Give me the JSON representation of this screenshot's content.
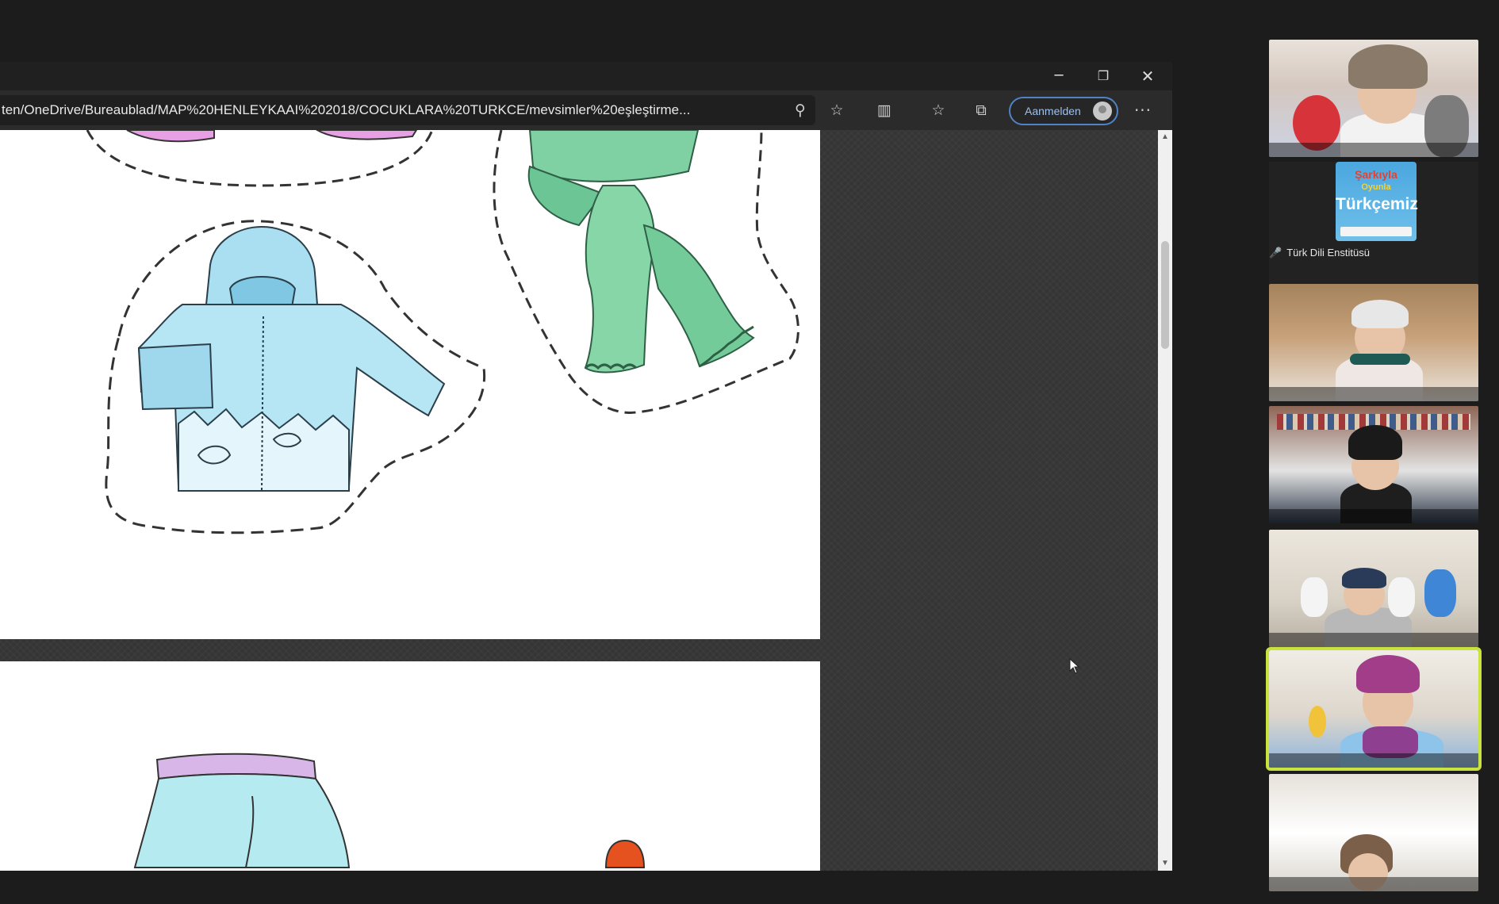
{
  "browser": {
    "window_controls": {
      "minimize": "─",
      "restore": "❐",
      "close": "✕"
    },
    "address": "ten/OneDrive/Bureaublad/MAP%20HENLEYKAAI%202018/COCUKLARA%20TURKCE/mevsimler%20eşleştirme...",
    "signin_label": "Aanmelden",
    "icons": {
      "zoom": "zoom-icon",
      "add_favorite": "favorite-add-icon",
      "reader": "immersive-reader-icon",
      "favorites": "favorites-icon",
      "collections": "collections-icon",
      "more": "more-icon"
    },
    "glyphs": {
      "zoom": "⚲",
      "add_favorite": "☆",
      "reader": "▥",
      "favorites": "☆",
      "collections": "⧉",
      "more": "···"
    }
  },
  "document": {
    "items": [
      "scarf-drawing",
      "hooded-jacket-drawing",
      "pants-drawing",
      "boot-drawing"
    ]
  },
  "gallery": {
    "participants": [
      {
        "type": "video",
        "name": ""
      },
      {
        "type": "logo",
        "name": "Türk Dili Enstitüsü",
        "muted": true,
        "logo": {
          "line1": "Şarkıyla",
          "line2": "Oyunla",
          "line3": "Türkçemiz"
        }
      },
      {
        "type": "video",
        "name": ""
      },
      {
        "type": "video",
        "name": ""
      },
      {
        "type": "video",
        "name": ""
      },
      {
        "type": "video",
        "name": "",
        "active_speaker": true
      },
      {
        "type": "video",
        "name": ""
      }
    ],
    "mic_muted_glyph": "🎤",
    "colors": {
      "active_speaker": "#c9e23e",
      "muted": "#e0413a"
    }
  }
}
